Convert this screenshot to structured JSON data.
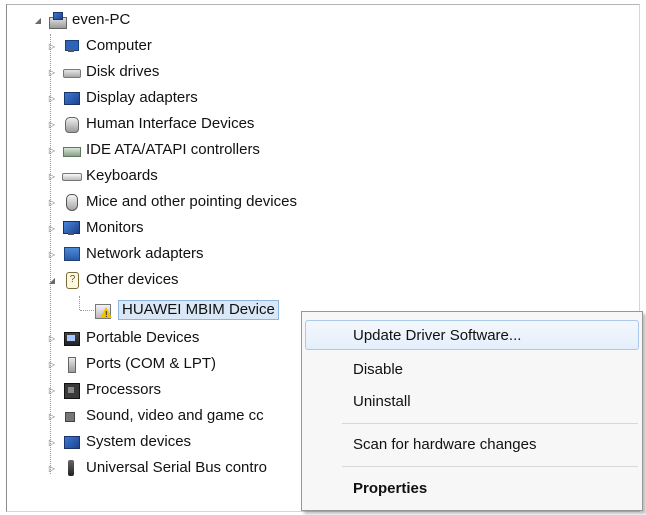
{
  "tree": {
    "root_label": "even-PC",
    "categories": [
      {
        "label": "Computer",
        "icon": "computer-icon"
      },
      {
        "label": "Disk drives",
        "icon": "disk-drive-icon"
      },
      {
        "label": "Display adapters",
        "icon": "display-adapter-icon"
      },
      {
        "label": "Human Interface Devices",
        "icon": "hid-icon"
      },
      {
        "label": "IDE ATA/ATAPI controllers",
        "icon": "ide-controller-icon"
      },
      {
        "label": "Keyboards",
        "icon": "keyboard-icon"
      },
      {
        "label": "Mice and other pointing devices",
        "icon": "mouse-icon"
      },
      {
        "label": "Monitors",
        "icon": "monitor-icon"
      },
      {
        "label": "Network adapters",
        "icon": "network-adapter-icon"
      },
      {
        "label": "Other devices",
        "icon": "other-devices-icon"
      },
      {
        "label": "Portable Devices",
        "icon": "portable-device-icon"
      },
      {
        "label": "Ports (COM & LPT)",
        "icon": "port-icon"
      },
      {
        "label": "Processors",
        "icon": "processor-icon"
      },
      {
        "label": "Sound, video and game cc",
        "icon": "sound-icon"
      },
      {
        "label": "System devices",
        "icon": "system-device-icon"
      },
      {
        "label": "Universal Serial Bus contro",
        "icon": "usb-icon"
      }
    ],
    "selected_child": {
      "label": "HUAWEI MBIM Device",
      "icon": "warning-device-icon"
    }
  },
  "context_menu": {
    "items": [
      {
        "label": "Update Driver Software..."
      },
      {
        "label": "Disable"
      },
      {
        "label": "Uninstall"
      },
      {
        "label": "Scan for hardware changes"
      },
      {
        "label": "Properties"
      }
    ]
  },
  "colors": {
    "selection_fill": "#d9e7f7",
    "menu_highlight_border": "#aac8ee",
    "warning_yellow": "#f2c200"
  }
}
